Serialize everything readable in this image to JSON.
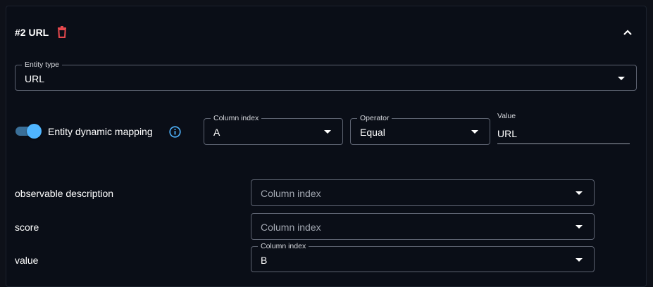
{
  "header": {
    "title": "#2 URL",
    "trash_icon": "trash-icon",
    "collapse_icon": "chevron-up-icon"
  },
  "entity_type": {
    "label": "Entity type",
    "value": "URL"
  },
  "dynamic_mapping": {
    "label": "Entity dynamic mapping",
    "enabled": true,
    "info_icon": "info-circle-icon",
    "column_index": {
      "label": "Column index",
      "value": "A"
    },
    "operator": {
      "label": "Operator",
      "value": "Equal"
    },
    "value": {
      "label": "Value",
      "value": "URL"
    }
  },
  "fields": [
    {
      "label": "observable description",
      "select_placeholder": "Column index"
    },
    {
      "label": "score",
      "select_placeholder": "Column index"
    },
    {
      "label": "value",
      "select_label": "Column index",
      "select_value": "B"
    }
  ],
  "colors": {
    "accent": "#4fb5ff",
    "danger": "#e5484d",
    "background": "#0a0e17",
    "border": "#5d6371"
  }
}
